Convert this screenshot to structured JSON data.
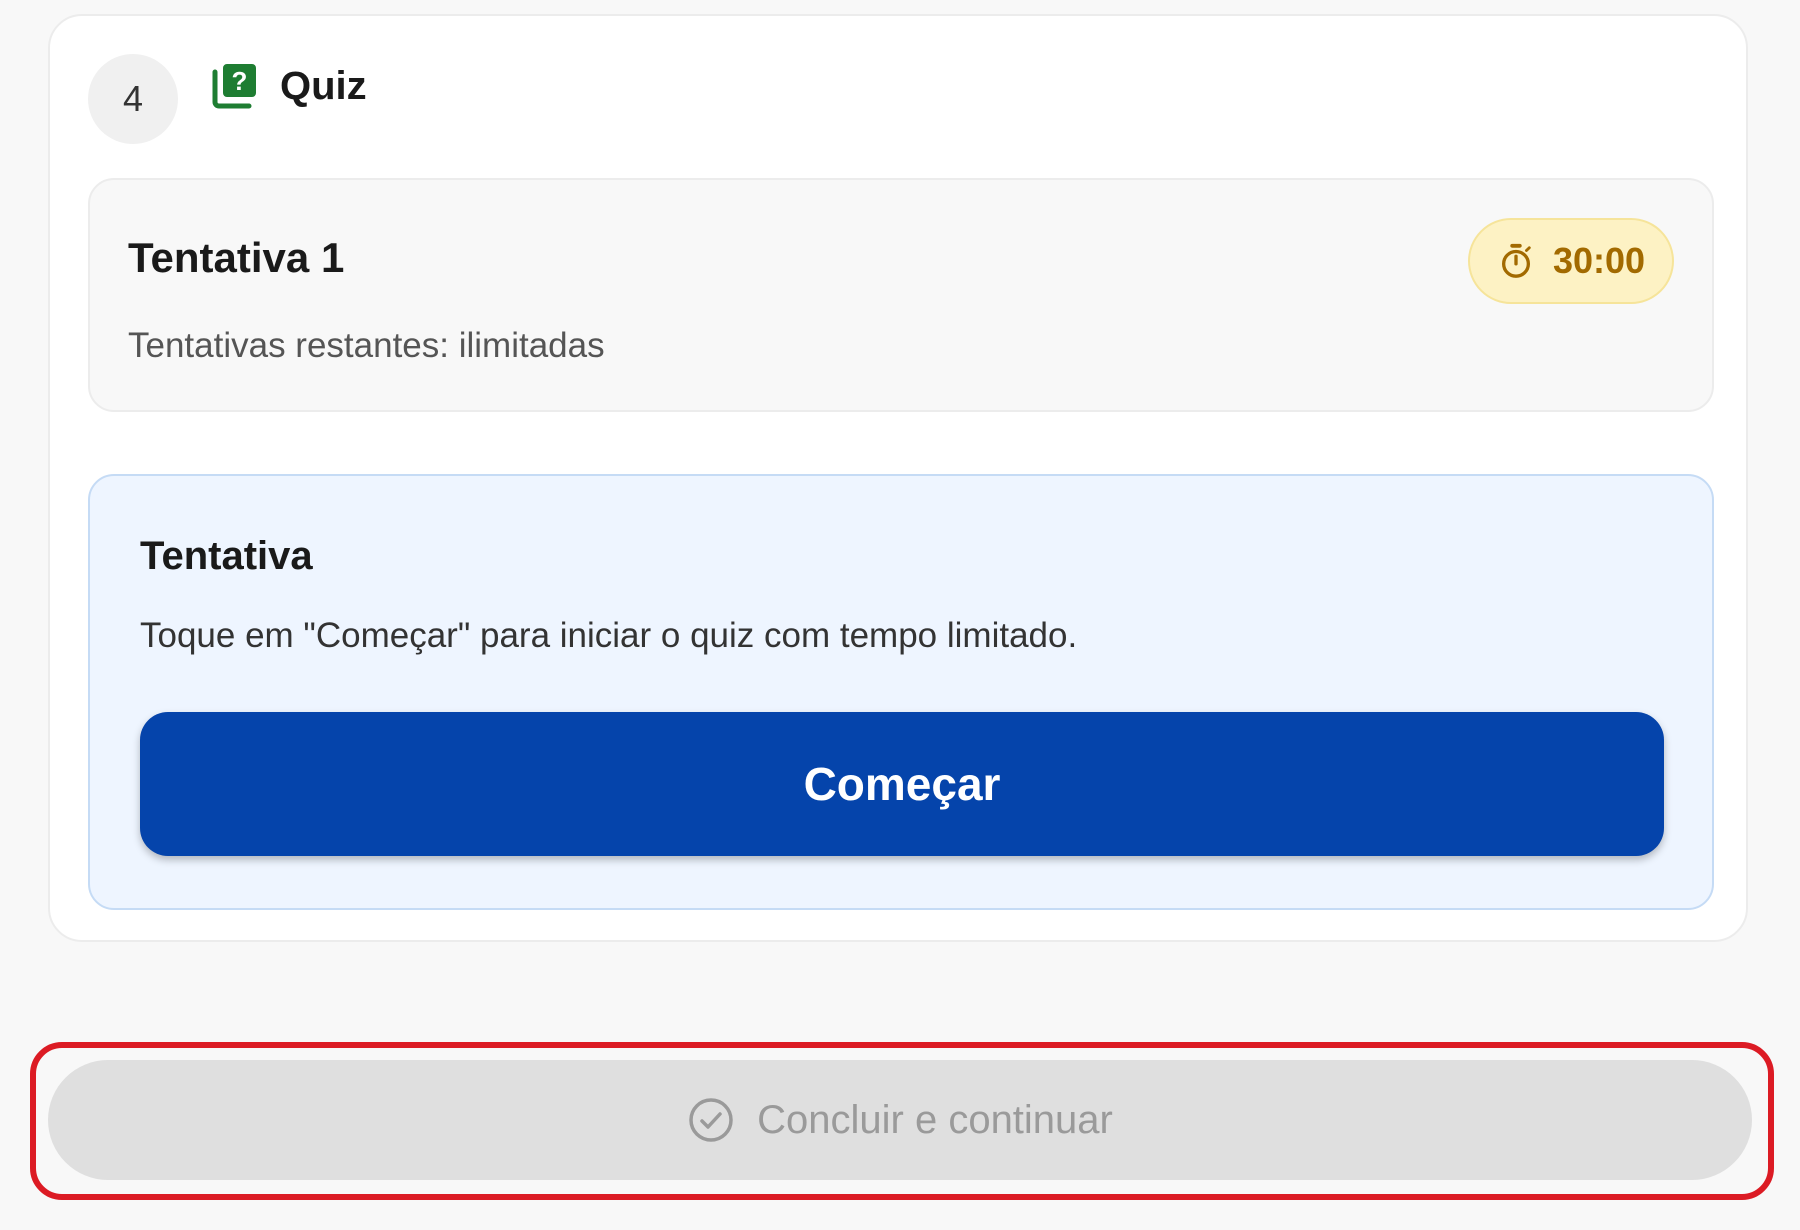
{
  "step": {
    "number": "4",
    "title": "Quiz",
    "icon": "quiz-icon"
  },
  "attempt": {
    "title": "Tentativa 1",
    "remaining": "Tentativas restantes: ilimitadas",
    "timer": "30:00",
    "timer_icon": "stopwatch-icon"
  },
  "info": {
    "title": "Tentativa",
    "description": "Toque em \"Começar\" para iniciar o quiz com tempo limitado.",
    "start_label": "Começar"
  },
  "footer": {
    "finish_label": "Concluir e continuar",
    "finish_icon": "check-circle-icon"
  },
  "colors": {
    "primary": "#0544ab",
    "quiz_icon": "#1e7d32",
    "timer_bg": "#fdf2c4",
    "timer_text": "#a26a00",
    "highlight": "#dc1b24",
    "disabled_bg": "#dfdfdf"
  }
}
